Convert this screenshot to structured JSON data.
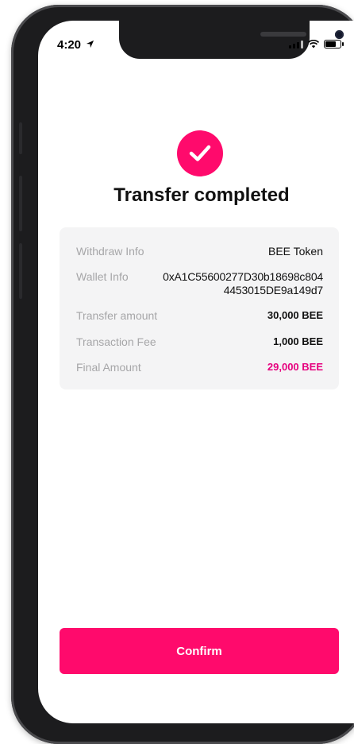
{
  "status_bar": {
    "time": "4:20"
  },
  "header": {
    "title": "Transfer completed"
  },
  "details": {
    "withdraw_label": "Withdraw Info",
    "withdraw_value": "BEE Token",
    "wallet_label": "Wallet Info",
    "wallet_line1": "0xA1C55600277D30b18698c804",
    "wallet_line2": "4453015DE9a149d7",
    "amount_label": "Transfer amount",
    "amount_value": "30,000 BEE",
    "fee_label": "Transaction Fee",
    "fee_value": "1,000 BEE",
    "final_label": "Final Amount",
    "final_value": "29,000 BEE"
  },
  "actions": {
    "confirm_label": "Confirm"
  },
  "colors": {
    "accent": "#ff0a6c",
    "final_amount": "#e6007e",
    "panel": "#f4f4f5"
  },
  "icons": {
    "status": "check-icon",
    "location": "location-arrow-icon"
  }
}
